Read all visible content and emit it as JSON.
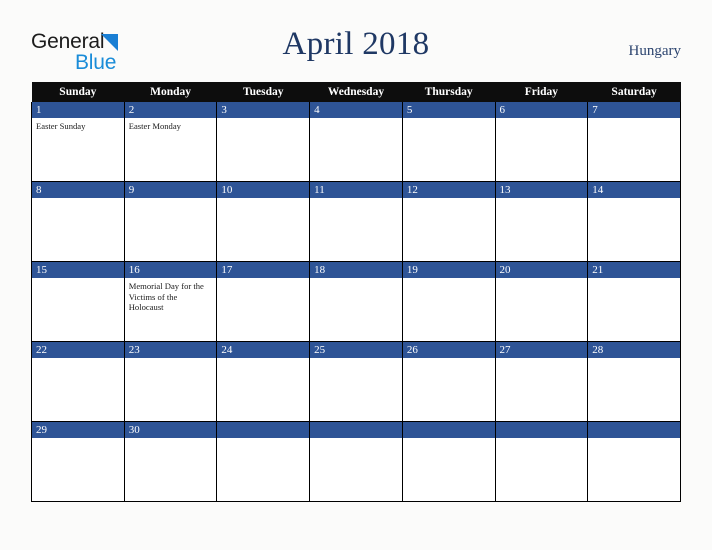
{
  "brand": {
    "line1": "General",
    "line2": "Blue",
    "triangle_icon": "blue-triangle"
  },
  "header": {
    "title": "April 2018",
    "country": "Hungary"
  },
  "colors": {
    "title": "#1f3864",
    "country": "#2b436e",
    "daybar": "#2e5496",
    "header_row": "#0d0d0d",
    "brand_dark": "#1c1c1c",
    "brand_blue": "#1a8cd8",
    "page_background": "#fbfbfa"
  },
  "calendar": {
    "weekday_headers": [
      "Sunday",
      "Monday",
      "Tuesday",
      "Wednesday",
      "Thursday",
      "Friday",
      "Saturday"
    ],
    "weeks": [
      [
        {
          "date": "1",
          "events": [
            "Easter Sunday"
          ]
        },
        {
          "date": "2",
          "events": [
            "Easter Monday"
          ]
        },
        {
          "date": "3",
          "events": []
        },
        {
          "date": "4",
          "events": []
        },
        {
          "date": "5",
          "events": []
        },
        {
          "date": "6",
          "events": []
        },
        {
          "date": "7",
          "events": []
        }
      ],
      [
        {
          "date": "8",
          "events": []
        },
        {
          "date": "9",
          "events": []
        },
        {
          "date": "10",
          "events": []
        },
        {
          "date": "11",
          "events": []
        },
        {
          "date": "12",
          "events": []
        },
        {
          "date": "13",
          "events": []
        },
        {
          "date": "14",
          "events": []
        }
      ],
      [
        {
          "date": "15",
          "events": []
        },
        {
          "date": "16",
          "events": [
            "Memorial Day for the Victims of the Holocaust"
          ]
        },
        {
          "date": "17",
          "events": []
        },
        {
          "date": "18",
          "events": []
        },
        {
          "date": "19",
          "events": []
        },
        {
          "date": "20",
          "events": []
        },
        {
          "date": "21",
          "events": []
        }
      ],
      [
        {
          "date": "22",
          "events": []
        },
        {
          "date": "23",
          "events": []
        },
        {
          "date": "24",
          "events": []
        },
        {
          "date": "25",
          "events": []
        },
        {
          "date": "26",
          "events": []
        },
        {
          "date": "27",
          "events": []
        },
        {
          "date": "28",
          "events": []
        }
      ],
      [
        {
          "date": "29",
          "events": []
        },
        {
          "date": "30",
          "events": []
        },
        {
          "date": "",
          "events": []
        },
        {
          "date": "",
          "events": []
        },
        {
          "date": "",
          "events": []
        },
        {
          "date": "",
          "events": []
        },
        {
          "date": "",
          "events": []
        }
      ]
    ]
  }
}
